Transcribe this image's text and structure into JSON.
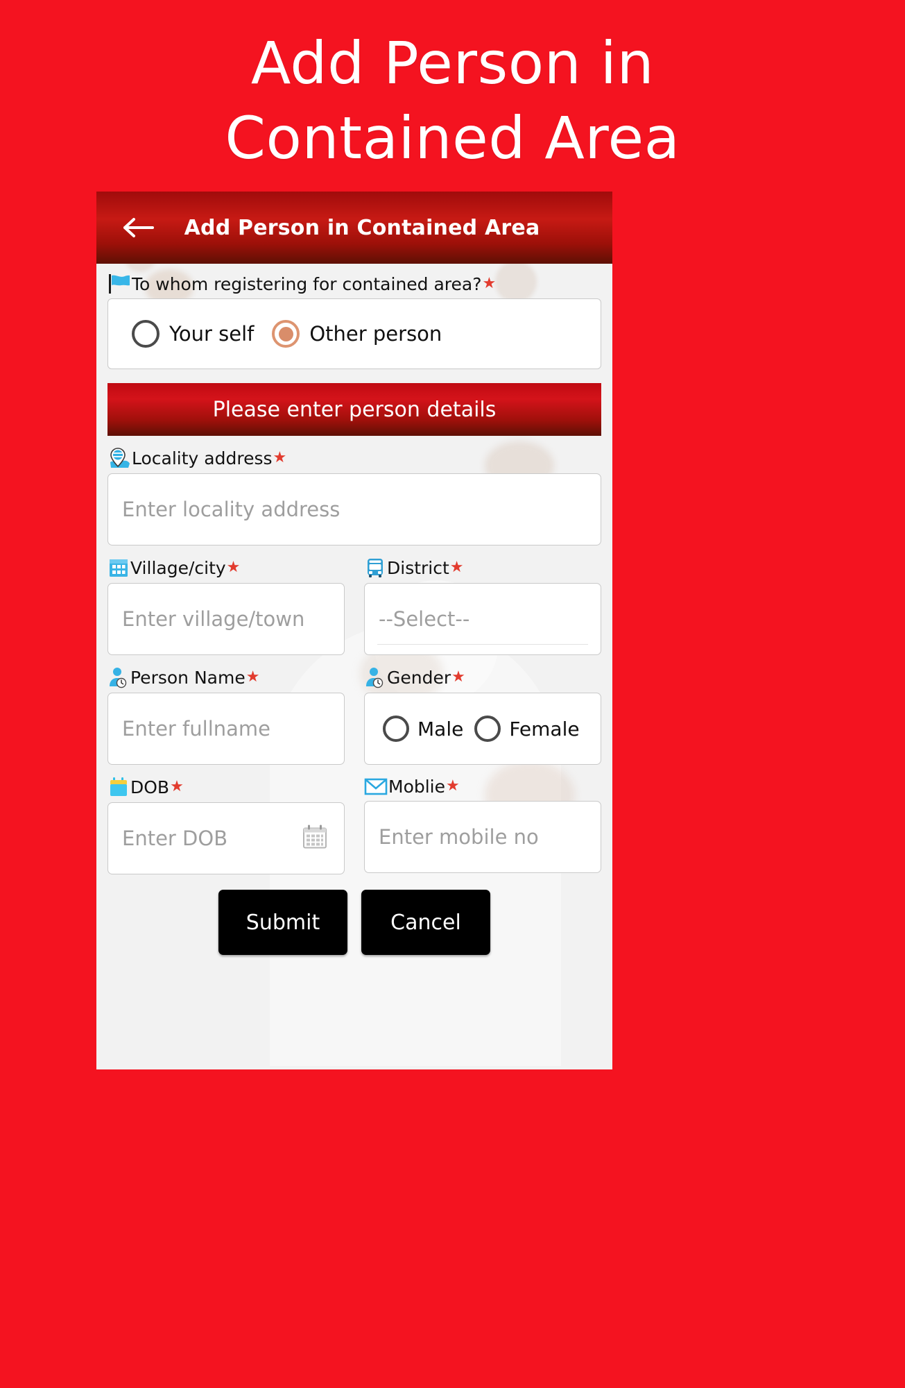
{
  "promo": {
    "headline_line1": "Add Person in",
    "headline_line2": "Contained Area",
    "background_color": "#f41320"
  },
  "appbar": {
    "title": "Add Person in Contained Area",
    "back_icon": "back-arrow-icon",
    "gradient_start": "#c71a14",
    "gradient_end": "#5e1004"
  },
  "form": {
    "question": {
      "label": "To whom registering for contained area?",
      "required_mark": "★",
      "icon": "flag-icon",
      "options": [
        {
          "label": "Your self",
          "selected": false
        },
        {
          "label": "Other person",
          "selected": true
        }
      ]
    },
    "section_banner": "Please enter person details",
    "fields": {
      "locality": {
        "label": "Locality address",
        "required_mark": "★",
        "icon": "map-pin-icon",
        "placeholder": "Enter locality address",
        "value": ""
      },
      "village": {
        "label": "Village/city",
        "required_mark": "★",
        "icon": "building-icon",
        "placeholder": "Enter village/town",
        "value": ""
      },
      "district": {
        "label": "District",
        "required_mark": "★",
        "icon": "bus-icon",
        "placeholder": "--Select--",
        "value": "--Select--"
      },
      "person_name": {
        "label": "Person Name",
        "required_mark": "★",
        "icon": "person-icon",
        "placeholder": "Enter fullname",
        "value": ""
      },
      "gender": {
        "label": "Gender",
        "required_mark": "★",
        "icon": "person-icon",
        "options": [
          {
            "label": "Male",
            "selected": false
          },
          {
            "label": "Female",
            "selected": false
          }
        ]
      },
      "dob": {
        "label": "DOB",
        "required_mark": "★",
        "icon": "calendar-icon",
        "placeholder": "Enter DOB",
        "value": "",
        "trailing_icon": "calendar-picker-icon"
      },
      "mobile": {
        "label": "Moblie",
        "required_mark": "★",
        "icon": "envelope-icon",
        "placeholder": "Enter mobile no",
        "value": ""
      }
    },
    "buttons": {
      "submit": "Submit",
      "cancel": "Cancel"
    }
  },
  "colors": {
    "accent_red": "#f41320",
    "banner_red": "#c00a12",
    "required_star": "#e23b2e",
    "selected_radio": "#d98d6a",
    "button_black": "#000000",
    "placeholder_gray": "#9e9e9e"
  }
}
